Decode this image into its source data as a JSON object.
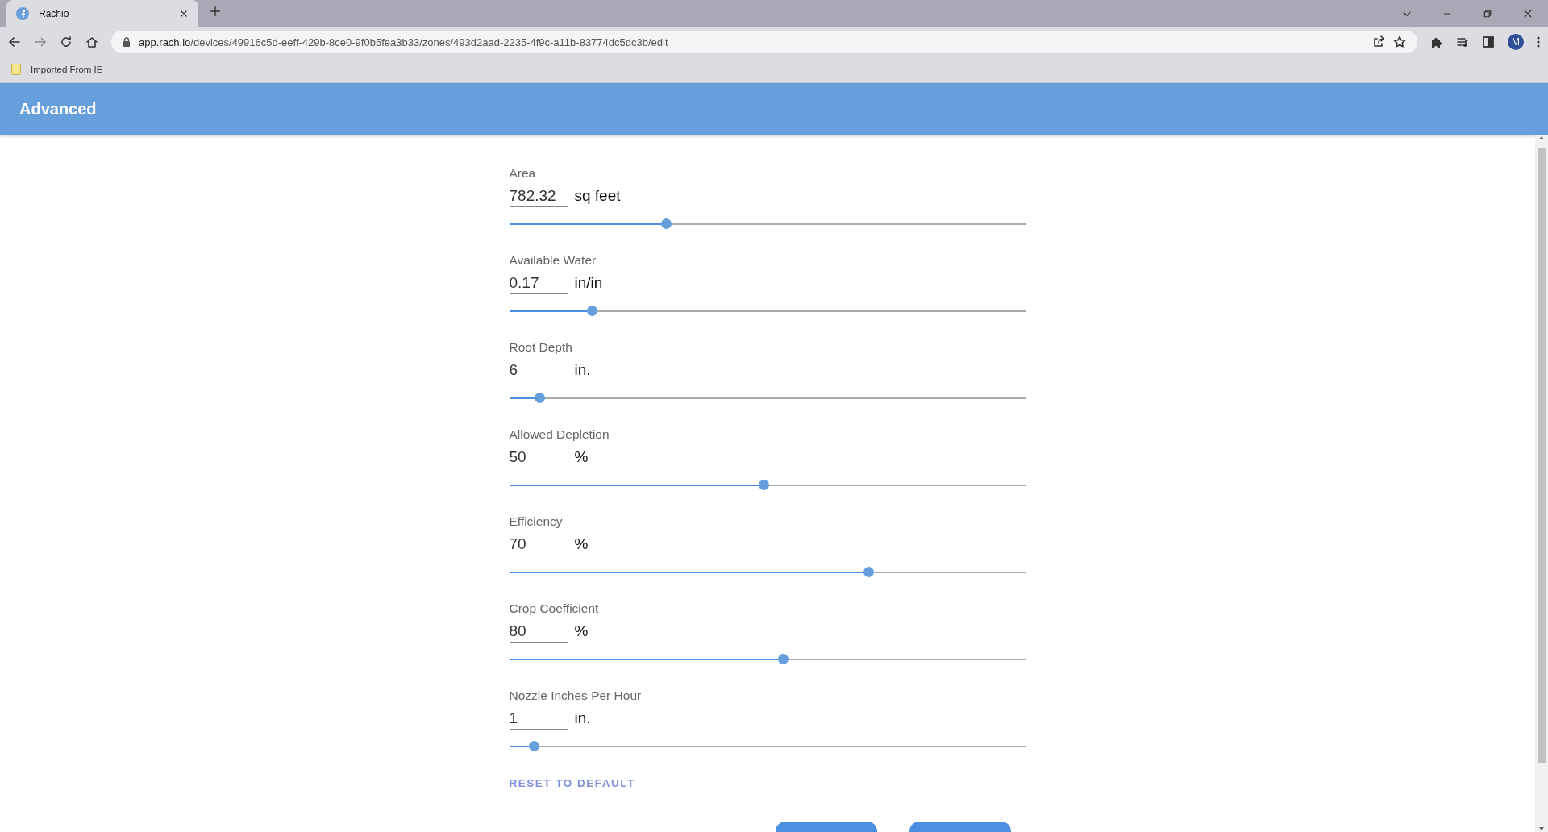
{
  "browser": {
    "tab": {
      "title": "Rachio"
    },
    "url": {
      "host": "app.rach.io",
      "path": "/devices/49916c5d-eeff-429b-8ce0-9f0b5fea3b33/zones/493d2aad-2235-4f9c-a11b-83774dc5dc3b/edit"
    },
    "bookmarks": [
      {
        "label": "Imported From IE"
      }
    ],
    "profile": "M"
  },
  "header": {
    "title": "Advanced"
  },
  "fields": [
    {
      "label": "Area",
      "value": "782.32",
      "unit": "sq feet",
      "level": 0.304
    },
    {
      "label": "Available Water",
      "value": "0.17",
      "unit": "in/in",
      "level": 0.161
    },
    {
      "label": "Root Depth",
      "value": "6",
      "unit": "in.",
      "level": 0.059
    },
    {
      "label": "Allowed Depletion",
      "value": "50",
      "unit": "%",
      "level": 0.493
    },
    {
      "label": "Efficiency",
      "value": "70",
      "unit": "%",
      "level": 0.696
    },
    {
      "label": "Crop Coefficient",
      "value": "80",
      "unit": "%",
      "level": 0.53
    },
    {
      "label": "Nozzle Inches Per Hour",
      "value": "1",
      "unit": "in.",
      "level": 0.048
    }
  ],
  "reset_link": "RESET TO DEFAULT"
}
